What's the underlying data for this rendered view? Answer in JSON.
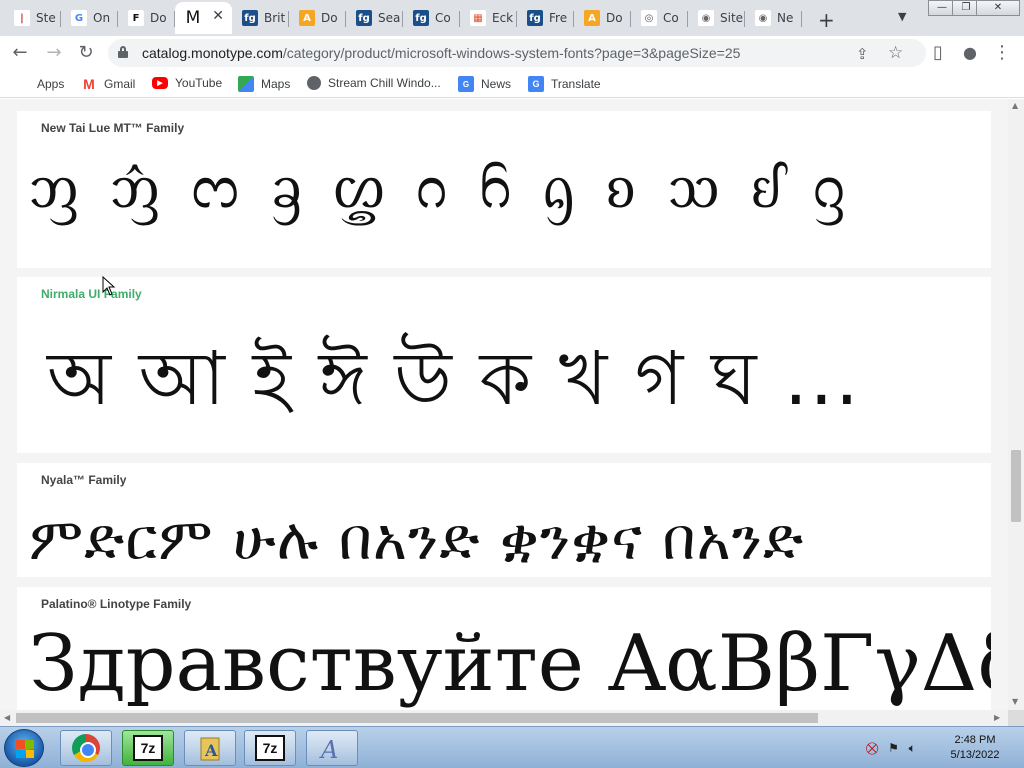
{
  "tabs": [
    {
      "label": "Ste",
      "fav_color": "#c62828",
      "fav_text": "|",
      "fav_bg": "#fff",
      "fav_fg": "#c62828"
    },
    {
      "label": "On",
      "fav_color": "#4285f4",
      "fav_text": "G",
      "fav_bg": "#fff",
      "fav_fg": "#4285f4"
    },
    {
      "label": "Do",
      "fav_color": "#111",
      "fav_text": "F",
      "fav_bg": "#fff",
      "fav_fg": "#111"
    },
    {
      "label": "",
      "fav_color": "#111",
      "fav_text": "M",
      "fav_bg": "#fff",
      "fav_fg": "#111",
      "active": true
    },
    {
      "label": "Brit",
      "fav_text": "fg",
      "fav_bg": "#1b4f8a",
      "fav_fg": "#fff"
    },
    {
      "label": "Do",
      "fav_text": "A",
      "fav_bg": "#f5a623",
      "fav_fg": "#fff"
    },
    {
      "label": "Sea",
      "fav_text": "fg",
      "fav_bg": "#1b4f8a",
      "fav_fg": "#fff"
    },
    {
      "label": "Co",
      "fav_text": "fg",
      "fav_bg": "#1b4f8a",
      "fav_fg": "#fff"
    },
    {
      "label": "Eck",
      "fav_text": "▦",
      "fav_bg": "#fff",
      "fav_fg": "#e0502a"
    },
    {
      "label": "Fre",
      "fav_text": "fg",
      "fav_bg": "#1b4f8a",
      "fav_fg": "#fff"
    },
    {
      "label": "Do",
      "fav_text": "A",
      "fav_bg": "#f5a623",
      "fav_fg": "#fff"
    },
    {
      "label": "Co",
      "fav_text": "◎",
      "fav_bg": "#fff",
      "fav_fg": "#555"
    },
    {
      "label": "Site",
      "fav_text": "◉",
      "fav_bg": "#fff",
      "fav_fg": "#666"
    },
    {
      "label": "Ne",
      "fav_text": "◉",
      "fav_bg": "#fff",
      "fav_fg": "#666"
    }
  ],
  "window_controls": {
    "minimize": "—",
    "restore": "❐",
    "close": "✕"
  },
  "toolbar": {
    "back": "←",
    "forward": "→",
    "reload": "↻",
    "url_host": "catalog.monotype.com",
    "url_path": "/category/product/microsoft-windows-system-fonts?page=3&pageSize=25",
    "share": "⇪",
    "star": "☆",
    "sidepanel": "▯",
    "profile": "●",
    "menu": "⋮"
  },
  "bookmarks": [
    {
      "label": "Apps",
      "icon": "apps-icon"
    },
    {
      "label": "Gmail",
      "icon": "gmail-icon"
    },
    {
      "label": "YouTube",
      "icon": "youtube-icon"
    },
    {
      "label": "Maps",
      "icon": "maps-icon"
    },
    {
      "label": "Stream Chill Windo...",
      "icon": "globe-icon"
    },
    {
      "label": "News",
      "icon": "news-icon"
    },
    {
      "label": "Translate",
      "icon": "translate-icon"
    }
  ],
  "families": [
    {
      "name": "New Tai Lue MT™ Family",
      "sample": "ᦀ ᦁ ᦂ ᦃ ᦄ ᦅ ᦆ ᦇ ᦈ ᦉ ᦊ ᦋ",
      "highlight": false
    },
    {
      "name": "Nirmala UI Family",
      "sample": "অ আ ই ঈ উ  ক খ গ ঘ ...",
      "highlight": true
    },
    {
      "name": "Nyala™ Family",
      "sample": "ምድርም ሁሉ በአንድ ቋንቋና በአንድ",
      "highlight": false
    },
    {
      "name": "Palatino® Linotype Family",
      "sample": "Здравствуйте ΑαΒβΓγΔδΕ",
      "highlight": false
    }
  ],
  "taskbar": {
    "apps": [
      "chrome",
      "7z",
      "folder",
      "7z",
      "fontviewer"
    ],
    "clock_time": "2:48 PM",
    "clock_date": "5/13/2022"
  }
}
